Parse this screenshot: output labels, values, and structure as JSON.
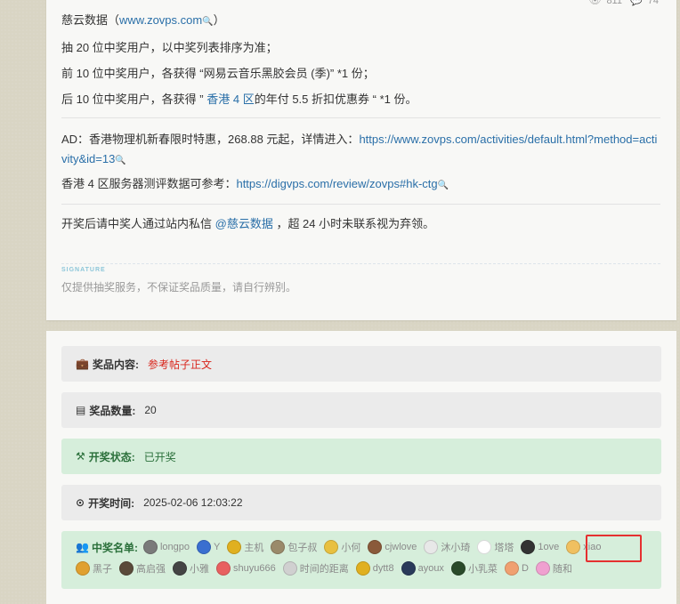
{
  "stats": {
    "views": "811",
    "comments": "74"
  },
  "post": {
    "line1_prefix": "慈云数据（",
    "line1_link": "www.zovps.com",
    "line1_suffix": "）",
    "line2": "抽 20 位中奖用户，以中奖列表排序为准；",
    "line3": "前 10 位中奖用户，各获得 “网易云音乐黑胶会员 (季)” *1 份；",
    "line4_prefix": "后 10 位中奖用户，各获得 ” ",
    "line4_link": "香港 4 区",
    "line4_suffix": "的年付 5.5 折扣优惠券 “ *1 份。",
    "ad_prefix": "AD：香港物理机新春限时特惠，268.88 元起，详情进入：",
    "ad_link": "https://www.zovps.com/activities/default.html?method=activity&id=13",
    "hk_prefix": "香港 4 区服务器测评数据可参考：",
    "hk_link": "https://digvps.com/review/zovps#hk-ctg",
    "contact_prefix": "开奖后请中奖人通过站内私信 ",
    "contact_link": "@慈云数据",
    "contact_suffix": " ，超 24 小时未联系视为弃领。"
  },
  "signature": {
    "label": "SIGNATURE",
    "text": "仅提供抽奖服务，不保证奖品质量，请自行辨别。"
  },
  "lottery": {
    "prize_key": "奖品内容:",
    "prize_value": "参考帖子正文",
    "count_key": "奖品数量:",
    "count_value": "20",
    "status_key": "开奖状态:",
    "status_value": "已开奖",
    "time_key": "开奖时间:",
    "time_value": "2025-02-06 12:03:22",
    "winners_key": "中奖名单:"
  },
  "winners_row1": [
    {
      "name": "longpo",
      "color": "#7a7a7a"
    },
    {
      "name": "Y",
      "color": "#3a6fd0"
    },
    {
      "name": "主机",
      "color": "#e0b020"
    },
    {
      "name": "包子叔",
      "color": "#9a8a6a"
    },
    {
      "name": "小何",
      "color": "#e8c040"
    },
    {
      "name": "cjwlove",
      "color": "#8a5a3a"
    },
    {
      "name": "沐小琦",
      "color": "#e8e8e8"
    },
    {
      "name": "塔塔",
      "color": "#ffffff"
    },
    {
      "name": "1ove",
      "color": "#333333"
    },
    {
      "name": "xiao",
      "color": "#f0c060"
    }
  ],
  "winners_row2": [
    {
      "name": "黑子",
      "color": "#e0a030"
    },
    {
      "name": "高启强",
      "color": "#5a4a3a"
    },
    {
      "name": "小雅",
      "color": "#444444"
    },
    {
      "name": "shuyu666",
      "color": "#e86060"
    },
    {
      "name": "时间的距离",
      "color": "#d0d0d0"
    },
    {
      "name": "dytt8",
      "color": "#e0b020"
    },
    {
      "name": "ayoux",
      "color": "#2a3a5a"
    },
    {
      "name": "小乳菜",
      "color": "#2a4a2a"
    },
    {
      "name": "D",
      "color": "#f0a070"
    },
    {
      "name": "随和",
      "color": "#f0a0d0"
    }
  ]
}
